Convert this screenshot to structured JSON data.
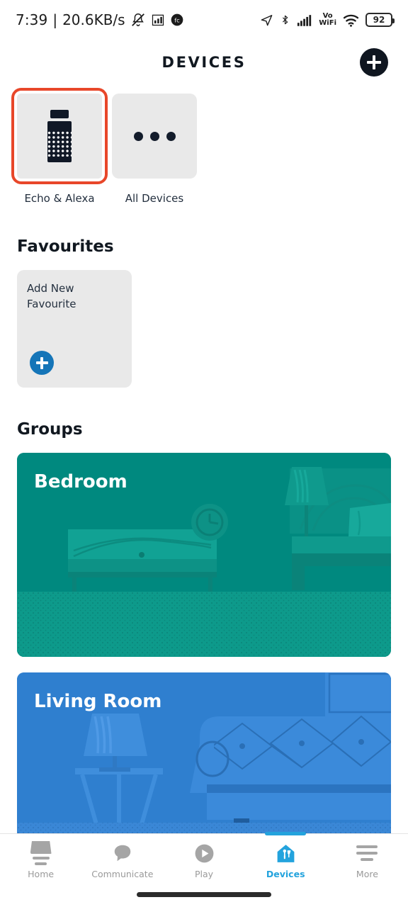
{
  "statusbar": {
    "time": "7:39",
    "separator": "|",
    "network_speed": "20.6KB/s",
    "icons": [
      "mute-icon",
      "signal-chart-icon",
      "fc-badge-icon",
      "navigation-arrow-icon",
      "bluetooth-icon",
      "cellular-signal-icon",
      "volte-wifi-icon",
      "wifi-icon"
    ],
    "volte_top": "Vo",
    "volte_bottom": "WiFi",
    "battery_percent": "92"
  },
  "header": {
    "title": "DEVICES",
    "add_button_name": "add-device-button"
  },
  "device_types": [
    {
      "label": "Echo & Alexa",
      "icon": "echo-speaker-icon",
      "selected": true
    },
    {
      "label": "All Devices",
      "icon": "ellipsis-icon",
      "selected": false
    }
  ],
  "favourites": {
    "heading": "Favourites",
    "cards": [
      {
        "label": "Add New\nFavourite",
        "action_icon": "plus-icon"
      }
    ]
  },
  "groups": {
    "heading": "Groups",
    "cards": [
      {
        "name": "Bedroom",
        "color": "#00897f",
        "art": "bedroom-illustration"
      },
      {
        "name": "Living Room",
        "color": "#2f7fcf",
        "art": "living-room-illustration"
      }
    ]
  },
  "bottom_nav": {
    "items": [
      {
        "label": "Home",
        "icon": "home-icon",
        "active": false
      },
      {
        "label": "Communicate",
        "icon": "speech-bubble-icon",
        "active": false
      },
      {
        "label": "Play",
        "icon": "play-circle-icon",
        "active": false
      },
      {
        "label": "Devices",
        "icon": "smart-home-icon",
        "active": true
      },
      {
        "label": "More",
        "icon": "hamburger-menu-icon",
        "active": false
      }
    ],
    "active_color": "#23a3dd",
    "inactive_color": "#a5a5a5"
  },
  "colors": {
    "accent_red": "#e8472a",
    "accent_blue": "#1575b8",
    "tile_gray": "#e9e9e9",
    "text_dark": "#111820"
  }
}
